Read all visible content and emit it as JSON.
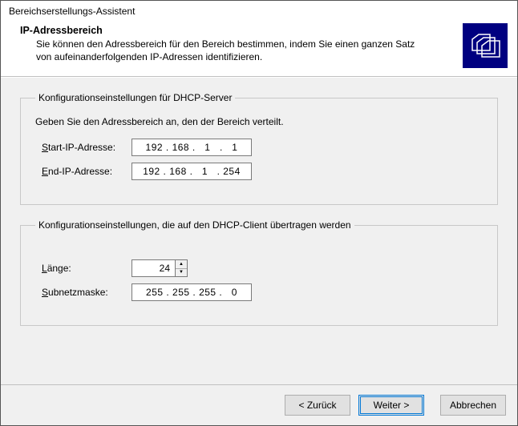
{
  "window": {
    "title": "Bereichserstellungs-Assistent"
  },
  "header": {
    "title": "IP-Adressbereich",
    "desc": "Sie können den Adressbereich für den Bereich bestimmen, indem Sie einen ganzen Satz von aufeinanderfolgenden IP-Adressen identifizieren."
  },
  "group1": {
    "legend": "Konfigurationseinstellungen für DHCP-Server",
    "instr": "Geben Sie den Adressbereich an, den der Bereich verteilt.",
    "start_prefix": "S",
    "start_suffix": "tart-IP-Adresse:",
    "start_value": "192 . 168 .   1   .   1",
    "end_prefix": "E",
    "end_suffix": "nd-IP-Adresse:",
    "end_value": "192 . 168 .   1   . 254"
  },
  "group2": {
    "legend": "Konfigurationseinstellungen, die auf den DHCP-Client übertragen werden",
    "length_prefix": "L",
    "length_suffix": "änge:",
    "length_value": "24",
    "mask_prefix": "S",
    "mask_suffix": "ubnetzmaske:",
    "mask_value": "255 . 255 . 255 .   0"
  },
  "footer": {
    "back": "< Zurück",
    "next": "Weiter >",
    "cancel": "Abbrechen"
  },
  "icons": {
    "spin_up": "▲",
    "spin_down": "▼"
  }
}
